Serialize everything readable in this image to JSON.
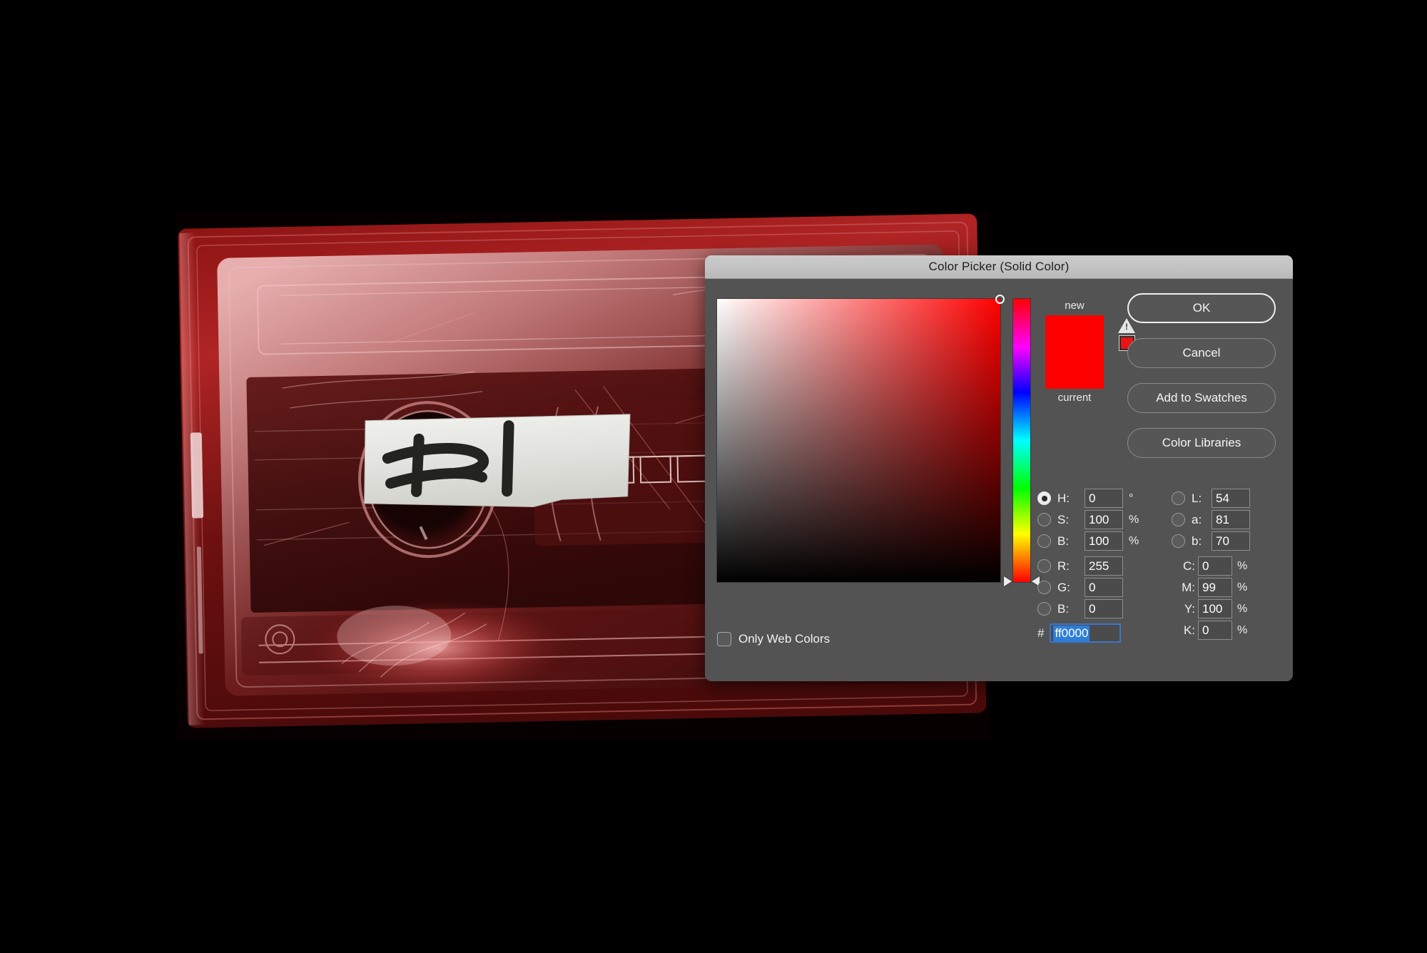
{
  "dialog": {
    "title": "Color Picker (Solid Color)",
    "buttons": [
      {
        "label": "OK",
        "name": "ok-button",
        "default": true
      },
      {
        "label": "Cancel",
        "name": "cancel-button",
        "default": false
      },
      {
        "label": "Add to Swatches",
        "name": "add-to-swatches-button",
        "default": false
      },
      {
        "label": "Color Libraries",
        "name": "color-libraries-button",
        "default": false
      }
    ],
    "only_web_colors": {
      "label": "Only Web Colors",
      "checked": false
    },
    "preview": {
      "new_label": "new",
      "current_label": "current",
      "new_color": "#ff0000",
      "current_color": "#ff0000",
      "gamut_warning_proof_color": "#e81414"
    },
    "selected_mode": "H",
    "hsb": {
      "h": {
        "label": "H:",
        "value": "0",
        "unit": "°"
      },
      "s": {
        "label": "S:",
        "value": "100",
        "unit": "%"
      },
      "b": {
        "label": "B:",
        "value": "100",
        "unit": "%"
      }
    },
    "rgb": {
      "r": {
        "label": "R:",
        "value": "255"
      },
      "g": {
        "label": "G:",
        "value": "0"
      },
      "b": {
        "label": "B:",
        "value": "0"
      }
    },
    "lab": {
      "l": {
        "label": "L:",
        "value": "54"
      },
      "a": {
        "label": "a:",
        "value": "81"
      },
      "b": {
        "label": "b:",
        "value": "70"
      }
    },
    "cmyk": {
      "c": {
        "label": "C:",
        "value": "0",
        "unit": "%"
      },
      "m": {
        "label": "M:",
        "value": "99",
        "unit": "%"
      },
      "y": {
        "label": "Y:",
        "value": "100",
        "unit": "%"
      },
      "k": {
        "label": "K:",
        "value": "0",
        "unit": "%"
      }
    },
    "hex": {
      "prefix": "#",
      "value": "ff0000",
      "selected": true
    },
    "colors": {
      "titlebar": "#c2c2c2",
      "body": "#535353",
      "field_bg": "#4b4b4b",
      "accent_selection": "#2f7ed6",
      "current_color": "#ff0000"
    }
  },
  "background": {
    "type": "photograph",
    "subject": "red-tinted cassette tape with handwritten masking-tape label",
    "canvas_color": "#000000"
  }
}
